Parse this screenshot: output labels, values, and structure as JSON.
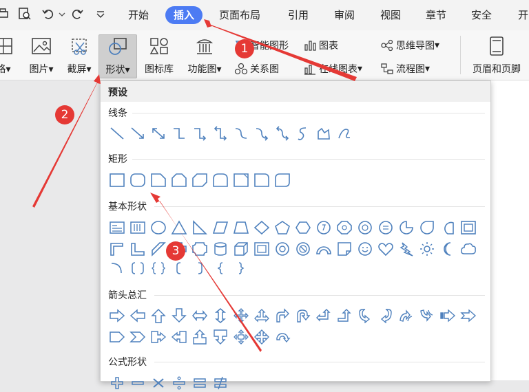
{
  "menu": {
    "tabs": [
      "开始",
      "插入",
      "页面布局",
      "引用",
      "审阅",
      "视图",
      "章节",
      "安全",
      "开"
    ],
    "active_tab": "插入",
    "active_color": "#4c7bf3"
  },
  "ribbon": {
    "table_label": "格",
    "picture_label": "图片",
    "screenshot_label": "截屏",
    "shapes_label": "形状",
    "icon_library_label": "图标库",
    "function_chart_label": "功能图",
    "smart_art_label": "智能图形",
    "chart_label": "图表",
    "relation_label": "关系图",
    "online_chart_label": "在线图表",
    "mindmap_label": "思维导图",
    "flowchart_label": "流程图",
    "header_footer_label": "页眉和页脚"
  },
  "panel": {
    "preset_title": "预设",
    "sections": {
      "lines": "线条",
      "rectangles": "矩形",
      "basic": "基本形状",
      "arrows": "箭头总汇",
      "formula": "公式形状"
    }
  },
  "annotations": {
    "badge_1": "1",
    "badge_2": "2",
    "badge_3": "3",
    "arrow_color": "#e53935"
  },
  "colors": {
    "shape_stroke": "#4f81bd"
  }
}
